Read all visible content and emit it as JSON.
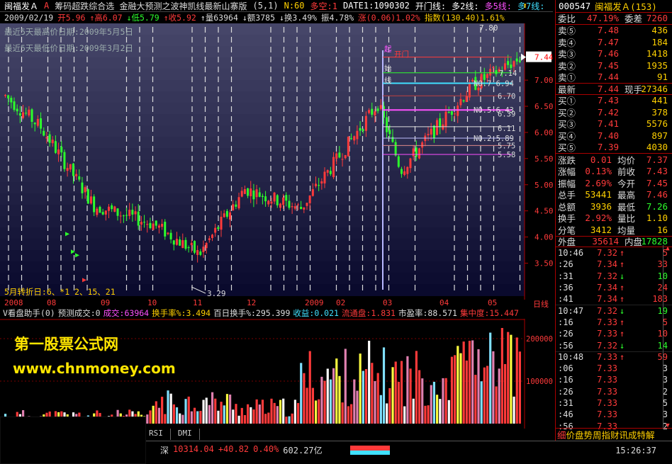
{
  "title": {
    "stock": "闽福发Ａ",
    "mark": "A",
    "indicators": "筹码超跌综合选  金融大预测之波神凯线最新山寨版",
    "params": "(5,1)",
    "n": "N:60",
    "duokong": "多空:1",
    "date1": "DATE1:1090302",
    "kaimen": "开门线:",
    "duo2": "多2线:",
    "duo5": "多5线:",
    "duo7": "多7线:"
  },
  "info": {
    "date": "2009/02/19",
    "open": "开5.96",
    "high": "↑高6.07",
    "low": "↓低5.79",
    "close": "↑收5.92",
    "vol": "↑量63964",
    "amt": "↓额3785",
    "turn": "↓换3.49%",
    "amp": "振4.78%",
    "chg": "涨(0.06)1.02%",
    "index": "指数(130.40)1.61%"
  },
  "notes": {
    "high_note": "最近5天最高价日期:2009年5月5日",
    "low_note": "最近5天最低价日期:2009年3月2日",
    "turn_note": "5月转折日:6、*1 2、15、21",
    "low_price": "3.29",
    "top_price": "7.80",
    "cur_price": "7.44",
    "lbl_qi": "起",
    "lbl_kaimen": "开门",
    "lbl_shi": "始",
    "lbl_xian": "线",
    "lbl_ma": "NO.7  6.94",
    "lbl_ma2": "6.70",
    "lbl_ma3": "NO.5  6.43",
    "lbl_ma4": "6.39",
    "lbl_ma5": "6.11",
    "lbl_ma6": "NO.2  5.89",
    "lbl_ma7": "5.75",
    "lbl_ma8": "5.58",
    "lbl_ma9": "7.14"
  },
  "price_axis": [
    "7.00",
    "6.50",
    "6.00",
    "5.50",
    "5.00",
    "4.50",
    "4.00",
    "3.50"
  ],
  "date_axis": [
    "2008",
    "08",
    "09",
    "10",
    "11",
    "12",
    "2009",
    "02",
    "03",
    "04",
    "05",
    "日线"
  ],
  "volume": {
    "name": "V看盘助手(0)",
    "pred": "预测成交:0",
    "vol": "成交:63964",
    "turn": "换手率%:3.494",
    "turn100": "百日换手%:295.399",
    "profit": "收益:0.021",
    "flow": "流通盘:1.831",
    "pe": "市盈率:88.571",
    "conc": "集中度:15.447",
    "axis": [
      "200000",
      "100000"
    ]
  },
  "watermark": {
    "line1": "第一股票公式网",
    "line2": "www.chnmoney.com"
  },
  "tabs": [
    "RSI",
    "DMI"
  ],
  "status": {
    "market": "深",
    "value": "10314.04",
    "chg": "+40.82",
    "pct": "0.40%",
    "amt": "602.27亿",
    "time": "15:26:37"
  },
  "panel": {
    "code": "000547",
    "name": "闽福发Ａ(153)",
    "weibi_l": "委比",
    "weibi": "47.19%",
    "weicha_l": "委差",
    "weicha": "7260",
    "sells": [
      {
        "label": "卖⑤",
        "price": "7.48",
        "vol": "436"
      },
      {
        "label": "卖④",
        "price": "7.47",
        "vol": "184"
      },
      {
        "label": "卖③",
        "price": "7.46",
        "vol": "1418"
      },
      {
        "label": "卖②",
        "price": "7.45",
        "vol": "1935"
      },
      {
        "label": "卖①",
        "price": "7.44",
        "vol": "91"
      }
    ],
    "latest_l": "最新",
    "latest": "7.44",
    "cur_l": "现手",
    "cur": "27346",
    "buys": [
      {
        "label": "买①",
        "price": "7.43",
        "vol": "441"
      },
      {
        "label": "买②",
        "price": "7.42",
        "vol": "378"
      },
      {
        "label": "买③",
        "price": "7.41",
        "vol": "5576"
      },
      {
        "label": "买④",
        "price": "7.40",
        "vol": "897"
      },
      {
        "label": "买⑤",
        "price": "7.39",
        "vol": "4030"
      }
    ],
    "stats": [
      {
        "l1": "涨跌",
        "v1": "0.01",
        "l2": "均价",
        "v2": "7.37"
      },
      {
        "l1": "涨幅",
        "v1": "0.13%",
        "l2": "前收",
        "v2": "7.43"
      },
      {
        "l1": "振幅",
        "v1": "2.69%",
        "l2": "今开",
        "v2": "7.45"
      },
      {
        "l1": "总手",
        "v1": "53441",
        "l2": "最高",
        "v2": "7.46"
      },
      {
        "l1": "总额",
        "v1": "3936",
        "l2": "最低",
        "v2": "7.26"
      },
      {
        "l1": "换手",
        "v1": "2.92%",
        "l2": "量比",
        "v2": "1.10"
      },
      {
        "l1": "分笔",
        "v1": "3412",
        "l2": "均量",
        "v2": "16"
      }
    ],
    "outer_l": "外盘",
    "outer": "35614",
    "inner_l": "内盘",
    "inner": "17828",
    "ticks": [
      {
        "t": "10:46",
        "p": "7.32",
        "a": "↑",
        "v": "5"
      },
      {
        "t": ":26",
        "p": "7.34",
        "a": "↑",
        "v": "33"
      },
      {
        "t": ":31",
        "p": "7.32",
        "a": "↓",
        "v": "10"
      },
      {
        "t": ":36",
        "p": "7.34",
        "a": "↑",
        "v": "24"
      },
      {
        "t": ":41",
        "p": "7.34",
        "a": "↑",
        "v": "183"
      },
      {
        "t": "10:47",
        "p": "7.32",
        "a": "↓",
        "v": "19"
      },
      {
        "t": ":16",
        "p": "7.33",
        "a": "↑",
        "v": "5"
      },
      {
        "t": ":26",
        "p": "7.33",
        "a": "↑",
        "v": "10"
      },
      {
        "t": ":56",
        "p": "7.32",
        "a": "↓",
        "v": "14"
      },
      {
        "t": "10:48",
        "p": "7.33",
        "a": "↑",
        "v": "59"
      },
      {
        "t": ":06",
        "p": "7.33",
        "a": "",
        "v": "3"
      },
      {
        "t": ":16",
        "p": "7.33",
        "a": "",
        "v": "3"
      },
      {
        "t": ":26",
        "p": "7.33",
        "a": "",
        "v": "2"
      },
      {
        "t": ":31",
        "p": "7.33",
        "a": "",
        "v": "5"
      },
      {
        "t": ":46",
        "p": "7.33",
        "a": "",
        "v": "3"
      },
      {
        "t": ":56",
        "p": "7.33",
        "a": "",
        "v": "2"
      }
    ],
    "footer_l": "细",
    "footer": "价盘势周指财讯成特解"
  },
  "colors": {
    "up": "#ff3a3a",
    "down": "#2cff2c",
    "bg": "#000000",
    "grid": "#7a0000"
  }
}
